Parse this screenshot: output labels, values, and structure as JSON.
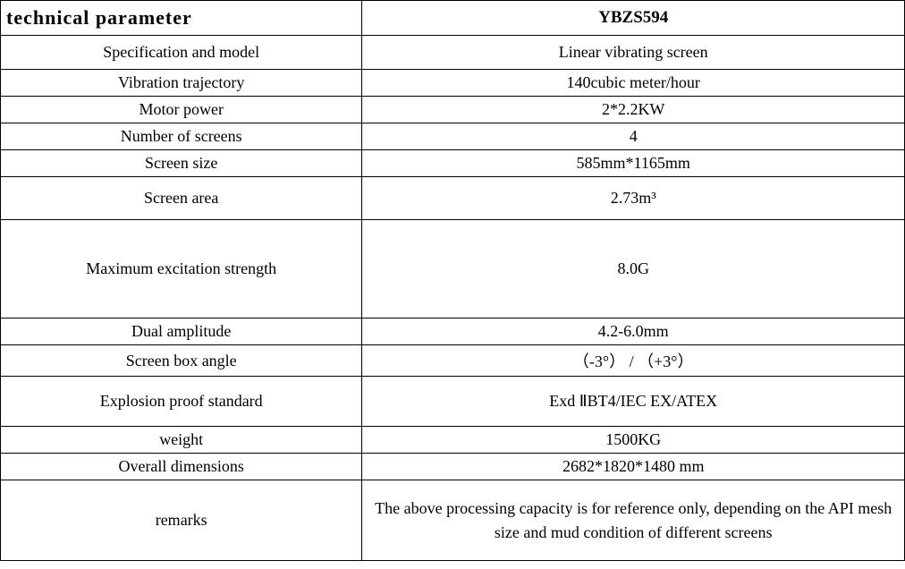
{
  "header": {
    "left": "technical parameter",
    "right": "YBZS594"
  },
  "rows": [
    {
      "label": "Specification and model",
      "value": "Linear vibrating screen"
    },
    {
      "label": "Vibration trajectory",
      "value": "140cubic meter/hour"
    },
    {
      "label": "Motor power",
      "value": "2*2.2KW"
    },
    {
      "label": "Number of screens",
      "value": "4"
    },
    {
      "label": "Screen size",
      "value": "585mm*1165mm"
    },
    {
      "label": "Screen area",
      "value": "2.73m³"
    },
    {
      "label": "Maximum excitation strength",
      "value": "8.0G"
    },
    {
      "label": "Dual amplitude",
      "value": "4.2-6.0mm"
    },
    {
      "label": "Screen box angle",
      "value": "（-3°） / （+3°）"
    },
    {
      "label": "Explosion proof standard",
      "value": "Exd ⅡBT4/IEC EX/ATEX"
    },
    {
      "label": "weight",
      "value": "1500KG"
    },
    {
      "label": "Overall dimensions",
      "value": "2682*1820*1480 mm"
    },
    {
      "label": "remarks",
      "value": "The above processing capacity is for reference only, depending on the API mesh size and mud condition of different screens"
    }
  ]
}
